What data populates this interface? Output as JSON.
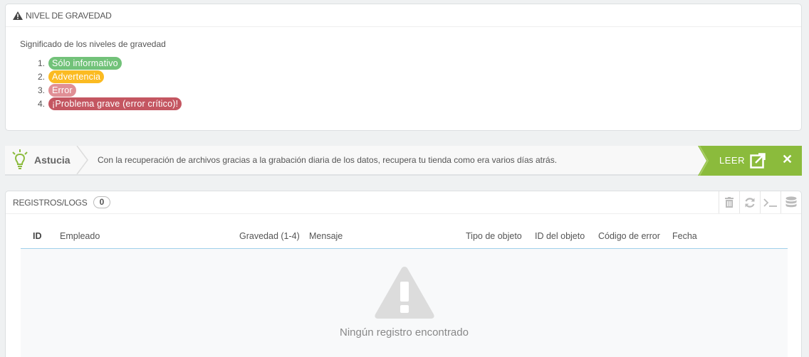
{
  "severity": {
    "title": "NIVEL DE GRAVEDAD",
    "description": "Significado de los niveles de gravedad",
    "levels": [
      {
        "num": "1.",
        "label": "Sólo informativo"
      },
      {
        "num": "2.",
        "label": "Advertencia"
      },
      {
        "num": "3.",
        "label": "Error"
      },
      {
        "num": "4.",
        "label": "¡Problema grave (error crítico)!"
      }
    ]
  },
  "tip": {
    "label": "Astucia",
    "text": "Con la recuperación de archivos gracias a la grabación diaria de los datos, recupera tu tienda como era varios días atrás.",
    "read_label": "LEER",
    "close": "✕",
    "accent": "#8bbb3c"
  },
  "logs": {
    "title": "REGISTROS/LOGS",
    "count": "0",
    "columns": {
      "id": "ID",
      "employee": "Empleado",
      "severity": "Gravedad (1-4)",
      "message": "Mensaje",
      "object_type": "Tipo de objeto",
      "object_id": "ID del objeto",
      "error_code": "Código de error",
      "date": "Fecha"
    },
    "empty_message": "Ningún registro encontrado",
    "toolbar": [
      "trash-icon",
      "refresh-icon",
      "terminal-icon",
      "database-icon"
    ]
  }
}
